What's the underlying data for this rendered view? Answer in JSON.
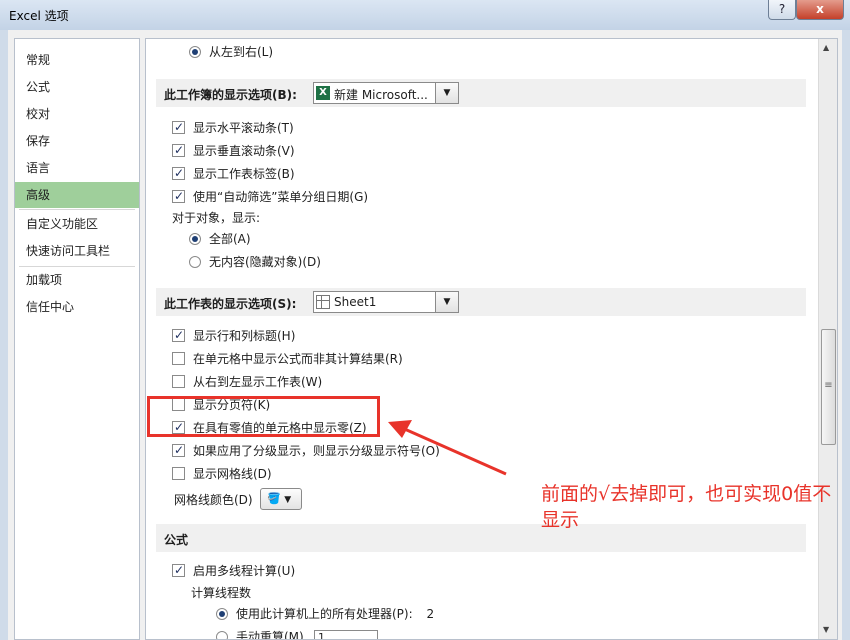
{
  "window": {
    "title": "Excel 选项",
    "help_label": "?",
    "close_label": "x"
  },
  "nav": {
    "items": [
      {
        "label": "常规",
        "active": false
      },
      {
        "label": "公式",
        "active": false
      },
      {
        "label": "校对",
        "active": false
      },
      {
        "label": "保存",
        "active": false
      },
      {
        "label": "语言",
        "active": false
      },
      {
        "label": "高级",
        "active": true
      },
      {
        "label": "自定义功能区",
        "active": false
      },
      {
        "label": "快速访问工具栏",
        "active": false
      },
      {
        "label": "加载项",
        "active": false
      },
      {
        "label": "信任中心",
        "active": false
      }
    ]
  },
  "pane": {
    "top_radio": {
      "label": "从左到右(L)",
      "checked": true
    },
    "workbook_section": {
      "title": "此工作簿的显示选项(B):",
      "dropdown_value": "新建 Microsoft...",
      "icon": "excel-icon",
      "options": [
        {
          "label": "显示水平滚动条(T)",
          "checked": true
        },
        {
          "label": "显示垂直滚动条(V)",
          "checked": true
        },
        {
          "label": "显示工作表标签(B)",
          "checked": true
        },
        {
          "label": "使用“自动筛选”菜单分组日期(G)",
          "checked": true
        }
      ],
      "objects_label": "对于对象，显示:",
      "objects_radios": [
        {
          "label": "全部(A)",
          "checked": true
        },
        {
          "label": "无内容(隐藏对象)(D)",
          "checked": false
        }
      ]
    },
    "sheet_section": {
      "title": "此工作表的显示选项(S):",
      "dropdown_value": "Sheet1",
      "icon": "sheet-icon",
      "options": [
        {
          "label": "显示行和列标题(H)",
          "checked": true
        },
        {
          "label": "在单元格中显示公式而非其计算结果(R)",
          "checked": false
        },
        {
          "label": "从右到左显示工作表(W)",
          "checked": false
        },
        {
          "label": "显示分页符(K)",
          "checked": false
        },
        {
          "label": "在具有零值的单元格中显示零(Z)",
          "checked": true
        },
        {
          "label": "如果应用了分级显示，则显示分级显示符号(O)",
          "checked": true
        },
        {
          "label": "显示网格线(D)",
          "checked": false
        }
      ],
      "gridline_color_label": "网格线颜色(D)",
      "gridline_color_icon": "paint-bucket-icon"
    },
    "formula_section": {
      "title": "公式",
      "multithread": {
        "label": "启用多线程计算(U)",
        "checked": true
      },
      "threads_label": "计算线程数",
      "all_processors": {
        "label": "使用此计算机上的所有处理器(P):",
        "value": "2",
        "checked": true
      },
      "manual": {
        "label": "手动重算(M)",
        "value": "1",
        "checked": false
      }
    }
  },
  "annotation": {
    "text": "前面的√去掉即可，也可实现0值不显示",
    "color": "#e8332a"
  }
}
